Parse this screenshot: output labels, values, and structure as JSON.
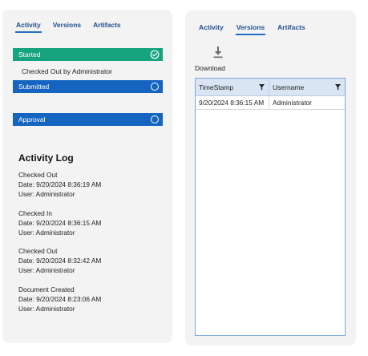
{
  "left_panel": {
    "tabs": [
      {
        "label": "Activity"
      },
      {
        "label": "Versions"
      },
      {
        "label": "Artifacts"
      }
    ],
    "active_tab": "Activity",
    "stages": {
      "started": {
        "label": "Started",
        "color": "#16a37f",
        "status": "complete"
      },
      "substatus": "Checked Out by Administrator",
      "submitted": {
        "label": "Submitted",
        "color": "#1565c0",
        "status": "pending"
      },
      "approval": {
        "label": "Approval",
        "color": "#1565c0",
        "status": "pending"
      }
    },
    "activity_log": {
      "title": "Activity Log",
      "entries": [
        {
          "action": "Checked Out",
          "date": "Date: 9/20/2024 8:36:19 AM",
          "user": "User: Administrator"
        },
        {
          "action": "Checked In",
          "date": "Date: 9/20/2024 8:36:15 AM",
          "user": "User: Administrator"
        },
        {
          "action": "Checked Out",
          "date": "Date: 9/20/2024 8:32:42 AM",
          "user": "User: Administrator"
        },
        {
          "action": "Document Created",
          "date": "Date: 9/20/2024 8:23:06 AM",
          "user": "User: Administrator"
        }
      ]
    }
  },
  "right_panel": {
    "tabs": [
      {
        "label": "Activity"
      },
      {
        "label": "Versions"
      },
      {
        "label": "Artifacts"
      }
    ],
    "active_tab": "Versions",
    "download": {
      "label": "Download",
      "icon": "download-icon"
    },
    "grid": {
      "columns": [
        "TimeStamp",
        "Username"
      ],
      "rows": [
        [
          "9/20/2024 8:36:15 AM",
          "Administrator"
        ]
      ]
    }
  }
}
